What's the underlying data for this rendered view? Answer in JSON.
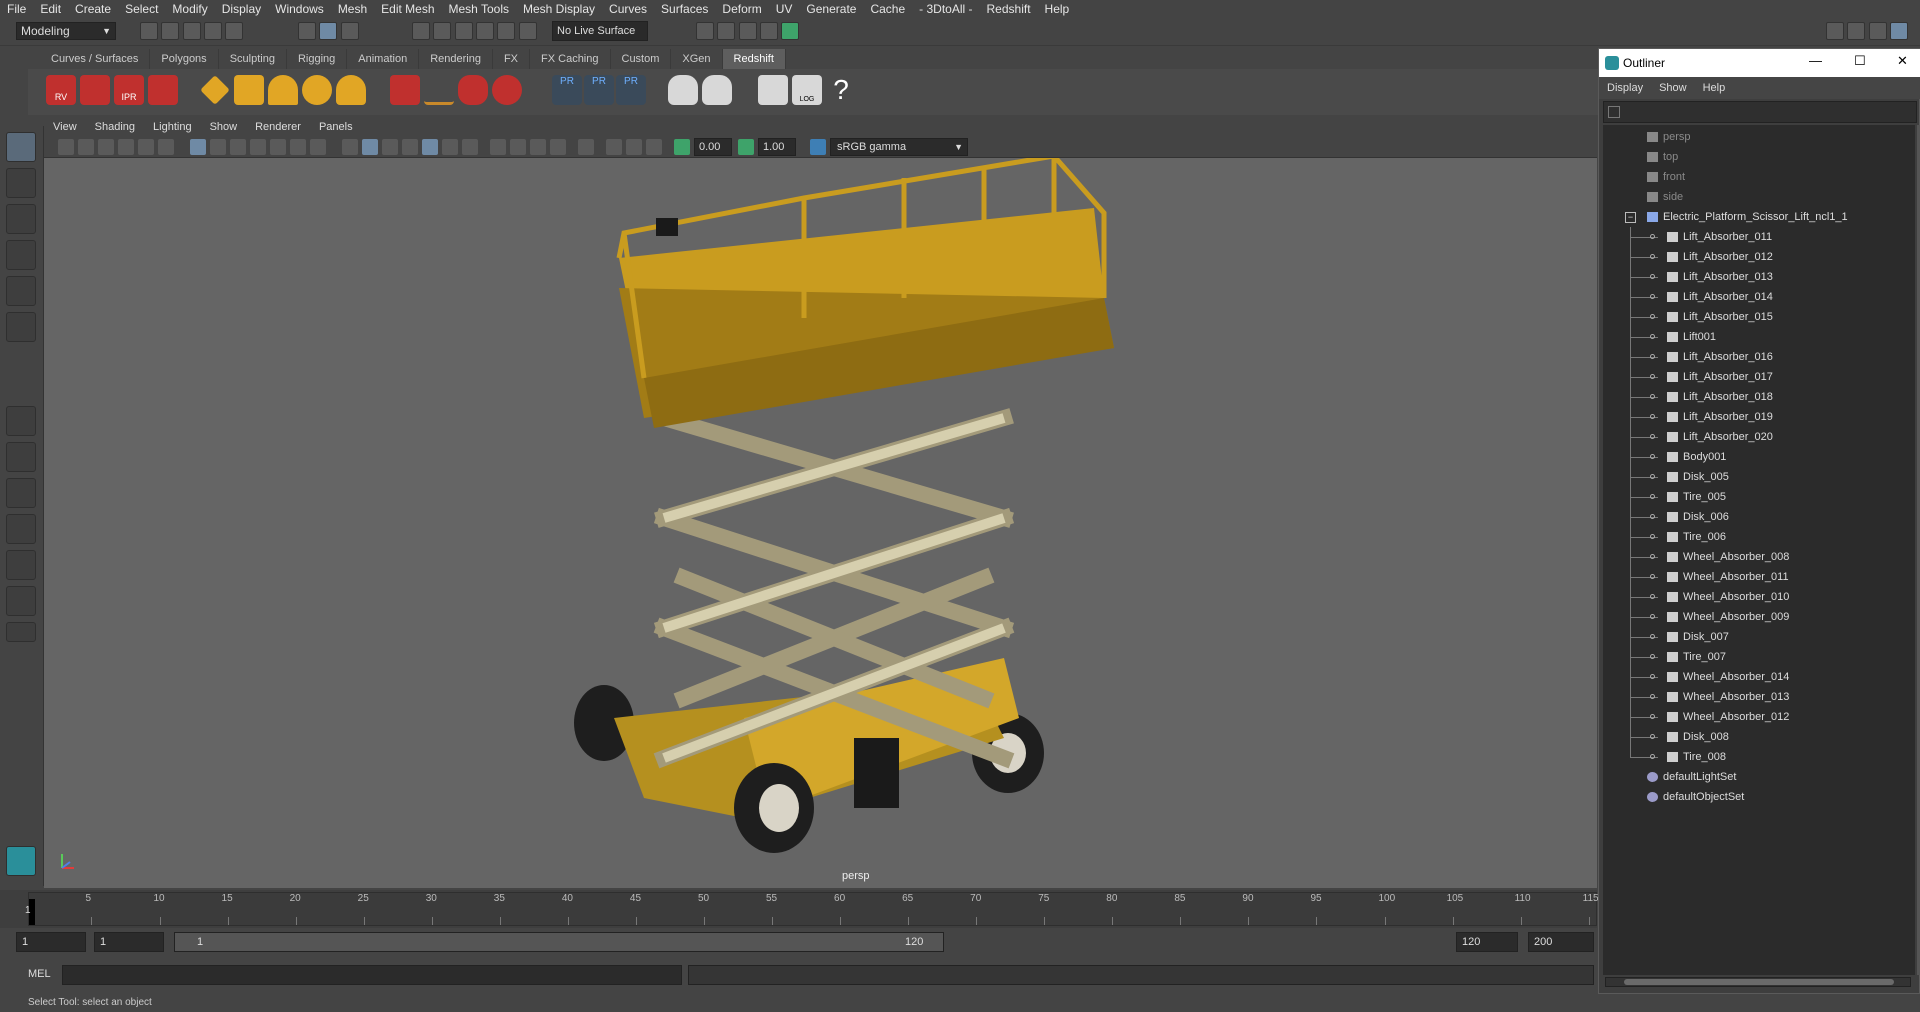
{
  "menubar": [
    "File",
    "Edit",
    "Create",
    "Select",
    "Modify",
    "Display",
    "Windows",
    "Mesh",
    "Edit Mesh",
    "Mesh Tools",
    "Mesh Display",
    "Curves",
    "Surfaces",
    "Deform",
    "UV",
    "Generate",
    "Cache",
    "- 3DtoAll -",
    "Redshift",
    "Help"
  ],
  "status_line": {
    "mode": "Modeling",
    "live_surface": "No Live Surface"
  },
  "shelf_tabs": [
    "Curves / Surfaces",
    "Polygons",
    "Sculpting",
    "Rigging",
    "Animation",
    "Rendering",
    "FX",
    "FX Caching",
    "Custom",
    "XGen",
    "Redshift"
  ],
  "active_shelf_tab": "Redshift",
  "shelf_icon_labels": {
    "rv": "RV",
    "ipr": "IPR",
    "pr1": "PR",
    "pr2": "PR",
    "pr3": "PR",
    "log": "LOG",
    "help": "?"
  },
  "viewport": {
    "menu": [
      "View",
      "Shading",
      "Lighting",
      "Show",
      "Renderer",
      "Panels"
    ],
    "exposure": "0.00",
    "gamma": "1.00",
    "color_space": "sRGB gamma",
    "camera_label": "persp"
  },
  "timeline": {
    "ticks": [
      "5",
      "10",
      "15",
      "20",
      "25",
      "30",
      "35",
      "40",
      "45",
      "50",
      "55",
      "60",
      "65",
      "70",
      "75",
      "80",
      "85",
      "90",
      "95",
      "100",
      "105",
      "110",
      "115"
    ],
    "current_frame": "1"
  },
  "range": {
    "start": "1",
    "anim_start": "1",
    "slider_start": "1",
    "slider_end": "120",
    "end": "120",
    "anim_end": "200"
  },
  "mel": {
    "label": "MEL"
  },
  "status_message": "Select Tool: select an object",
  "outliner": {
    "title": "Outliner",
    "menu": [
      "Display",
      "Show",
      "Help"
    ],
    "cameras": [
      "persp",
      "top",
      "front",
      "side"
    ],
    "root": "Electric_Platform_Scissor_Lift_ncl1_1",
    "children": [
      "Lift_Absorber_011",
      "Lift_Absorber_012",
      "Lift_Absorber_013",
      "Lift_Absorber_014",
      "Lift_Absorber_015",
      "Lift001",
      "Lift_Absorber_016",
      "Lift_Absorber_017",
      "Lift_Absorber_018",
      "Lift_Absorber_019",
      "Lift_Absorber_020",
      "Body001",
      "Disk_005",
      "Tire_005",
      "Disk_006",
      "Tire_006",
      "Wheel_Absorber_008",
      "Wheel_Absorber_011",
      "Wheel_Absorber_010",
      "Wheel_Absorber_009",
      "Disk_007",
      "Tire_007",
      "Wheel_Absorber_014",
      "Wheel_Absorber_013",
      "Wheel_Absorber_012",
      "Disk_008",
      "Tire_008"
    ],
    "sets": [
      "defaultLightSet",
      "defaultObjectSet"
    ]
  }
}
